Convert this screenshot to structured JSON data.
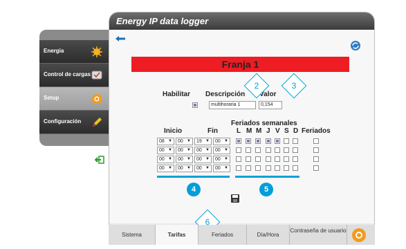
{
  "window": {
    "title": "Energy IP data logger"
  },
  "sidebar": {
    "items": [
      {
        "label": "Energia",
        "active": false
      },
      {
        "label": "Control de cargas",
        "active": false
      },
      {
        "label": "Setup",
        "active": true
      },
      {
        "label": "Configuración",
        "active": false
      }
    ]
  },
  "page": {
    "title": "Franja 1",
    "accent": "#ee1d23"
  },
  "form": {
    "habilitar_label": "Habilitar",
    "descripcion_label": "Descripción",
    "valor_label": "Valor",
    "descripcion_value": "multihoraria 1",
    "valor_value": "0,154",
    "feriados_semanales_label": "Feriados semanales",
    "inicio_label": "Inicio",
    "fin_label": "Fin",
    "feriados_label": "Feriados",
    "days": [
      "L",
      "M",
      "M",
      "J",
      "V",
      "S",
      "D"
    ]
  },
  "rows": [
    {
      "inicio_h": "08",
      "inicio_m": "00",
      "fin_h": "19",
      "fin_m": "00",
      "days": [
        true,
        true,
        true,
        true,
        true,
        false,
        false
      ]
    },
    {
      "inicio_h": "00",
      "inicio_m": "00",
      "fin_h": "00",
      "fin_m": "00",
      "days": [
        false,
        false,
        false,
        false,
        false,
        false,
        false
      ]
    },
    {
      "inicio_h": "00",
      "inicio_m": "00",
      "fin_h": "00",
      "fin_m": "00",
      "days": [
        false,
        false,
        false,
        false,
        false,
        false,
        false
      ]
    },
    {
      "inicio_h": "00",
      "inicio_m": "00",
      "fin_h": "00",
      "fin_m": "00",
      "days": [
        false,
        false,
        false,
        false,
        false,
        false,
        false
      ]
    }
  ],
  "callouts": {
    "c2": "2",
    "c3": "3",
    "c4": "4",
    "c5": "5",
    "c6": "6"
  },
  "tabs": [
    {
      "label": "Sistema"
    },
    {
      "label": "Tarifas",
      "active": true
    },
    {
      "label": "Feriados"
    },
    {
      "label": "Día/Hora"
    },
    {
      "label": "Contraseña de usuario"
    }
  ]
}
